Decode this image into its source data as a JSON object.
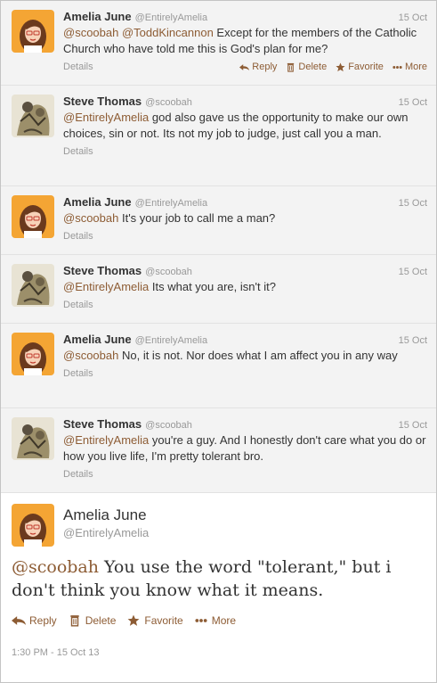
{
  "tweets": [
    {
      "name": "Amelia June",
      "handle": "@EntirelyAmelia",
      "time": "15 Oct",
      "mention1": "@scoobah",
      "mention2": "@ToddKincannon",
      "text": " Except for the members of the Catholic Church who have told me this is God's plan for me?",
      "details": "Details",
      "reply": "Reply",
      "delete": "Delete",
      "favorite": "Favorite",
      "more": "More"
    },
    {
      "name": "Steve Thomas",
      "handle": "@scoobah",
      "time": "15 Oct",
      "mention1": "@EntirelyAmelia",
      "text": " god also gave us the opportunity to make our own choices, sin or not. Its not my job to judge, just call you a man.",
      "details": "Details"
    },
    {
      "name": "Amelia June",
      "handle": "@EntirelyAmelia",
      "time": "15 Oct",
      "mention1": "@scoobah",
      "text": " It's your job to call me a man?",
      "details": "Details"
    },
    {
      "name": "Steve Thomas",
      "handle": "@scoobah",
      "time": "15 Oct",
      "mention1": "@EntirelyAmelia",
      "text": " Its what you are, isn't it?",
      "details": "Details"
    },
    {
      "name": "Amelia June",
      "handle": "@EntirelyAmelia",
      "time": "15 Oct",
      "mention1": "@scoobah",
      "text": " No, it is not. Nor does what I am affect you in any way",
      "details": "Details"
    },
    {
      "name": "Steve Thomas",
      "handle": "@scoobah",
      "time": "15 Oct",
      "mention1": "@EntirelyAmelia",
      "text": " you're a guy. And I honestly don't care what you do or how you live life, I'm pretty tolerant bro.",
      "details": "Details"
    }
  ],
  "main": {
    "name": "Amelia June",
    "handle": "@EntirelyAmelia",
    "mention": "@scoobah",
    "text": " You use the word \"tolerant,\" but i don't think you know what it means.",
    "reply": "Reply",
    "delete": "Delete",
    "favorite": "Favorite",
    "more": "More",
    "timestamp": "1:30 PM - 15 Oct 13"
  },
  "colors": {
    "accent": "#8d5c34",
    "background_reply": "#f3f3f3",
    "muted": "#999999"
  },
  "icons": {
    "reply": "reply-arrow-icon",
    "delete": "trash-icon",
    "favorite": "star-icon",
    "more": "more-dots-icon"
  }
}
